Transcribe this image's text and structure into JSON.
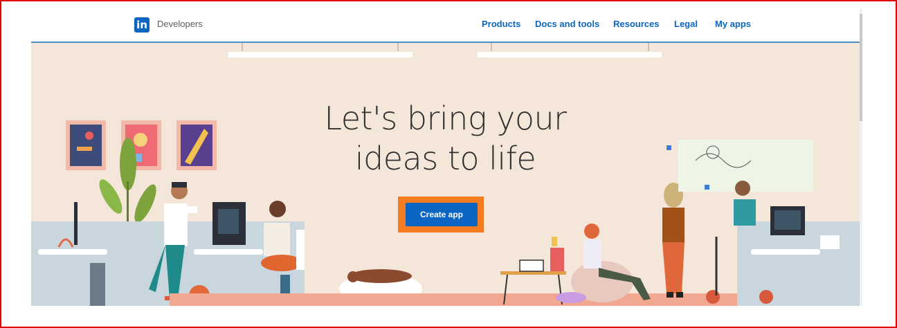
{
  "header": {
    "logo_text": "in",
    "brand": "Developers",
    "nav": [
      "Products",
      "Docs and tools",
      "Resources",
      "Legal",
      "My apps"
    ]
  },
  "hero": {
    "headline_line1": "Let's bring your",
    "headline_line2": "ideas to life",
    "cta_label": "Create app"
  },
  "colors": {
    "brand_blue": "#0a66c2",
    "hero_bg": "#f4e7d9",
    "highlight_orange": "#f47c20",
    "frame_red": "#e00000"
  }
}
